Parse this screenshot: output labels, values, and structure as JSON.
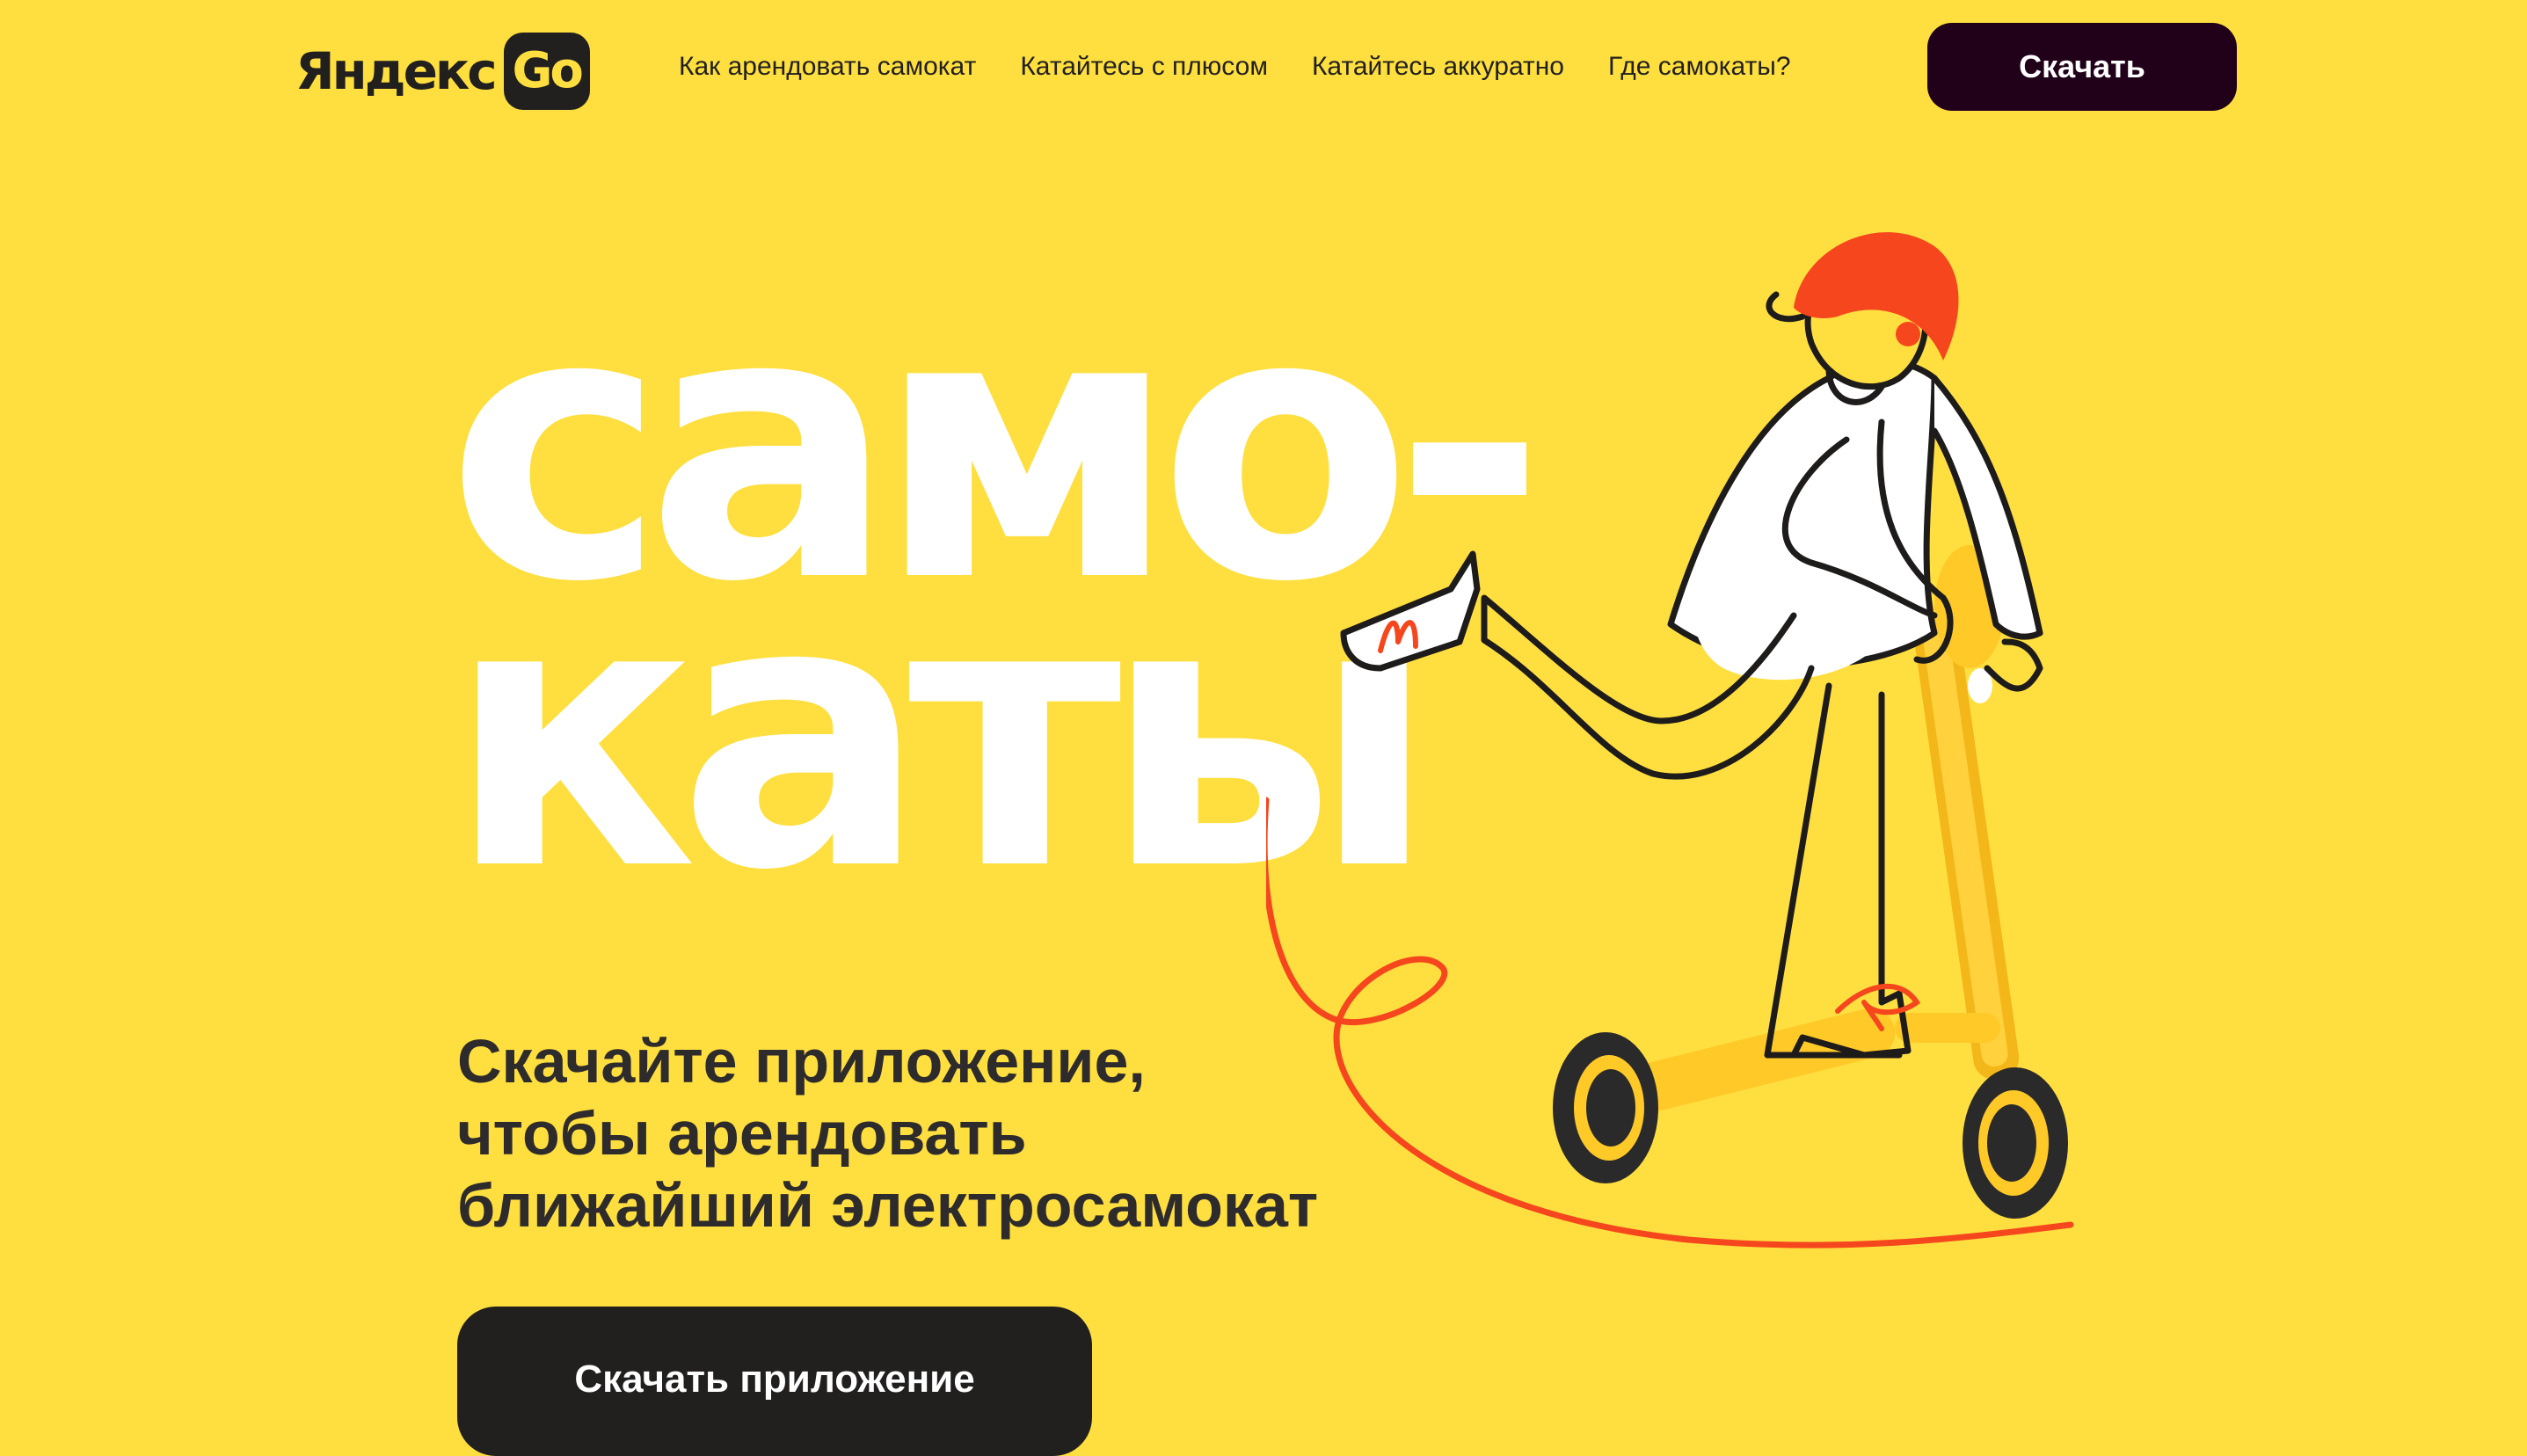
{
  "header": {
    "logo": {
      "word": "Яндекс",
      "badge": "Go"
    },
    "nav": [
      {
        "label": "Как арендовать самокат"
      },
      {
        "label": "Катайтесь с плюсом"
      },
      {
        "label": "Катайтесь аккуратно"
      },
      {
        "label": "Где самокаты?"
      }
    ],
    "download_label": "Скачать"
  },
  "hero": {
    "word_line1": "само-",
    "word_line2": "каты",
    "subtitle": "Скачайте приложение,\nчтобы арендовать\nближайший электросамокат",
    "cta_label": "Скачать приложение"
  },
  "colors": {
    "background": "#FFDF3F",
    "dark_button": "#21011A",
    "cta_button": "#21201F",
    "accent_red": "#F5461E",
    "scooter_yellow": "#FFC928"
  },
  "illustration": {
    "icon": "scooter-rider-illustration"
  }
}
